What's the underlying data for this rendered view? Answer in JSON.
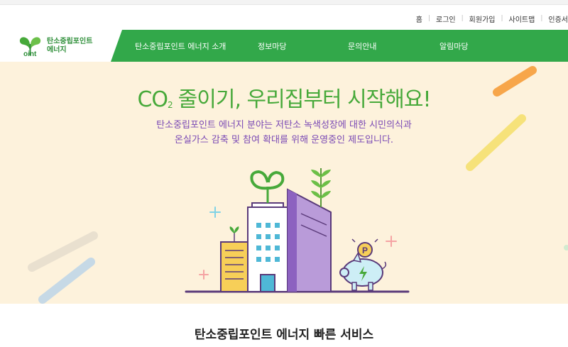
{
  "utility_nav": {
    "items": [
      "홈",
      "로그인",
      "회원가입",
      "사이트맵",
      "인증서"
    ]
  },
  "logo": {
    "line1": "탄소중립포인트",
    "line2": "에너지",
    "mark_text": "oint"
  },
  "gnb": {
    "items": [
      "탄소중립포인트 에너지 소개",
      "정보마당",
      "문의안내",
      "알림마당"
    ]
  },
  "hero": {
    "title_prefix": "CO",
    "title_sub": "2",
    "title_rest": "줄이기, 우리집부터 시작해요!",
    "desc_line1": "탄소중립포인트 에너지 분야는 저탄소 녹색성장에 대한 시민의식과",
    "desc_line2": "온실가스 감축 및 참여 확대를 위해 운영중인 제도입니다.",
    "coin_label": "P"
  },
  "quick_services": {
    "title": "탄소중립포인트 에너지 빠른 서비스"
  },
  "colors": {
    "brand_green": "#47a93a",
    "nav_green": "#32a84a",
    "hero_bg": "#fdf2dc",
    "purple": "#7a49b5"
  }
}
